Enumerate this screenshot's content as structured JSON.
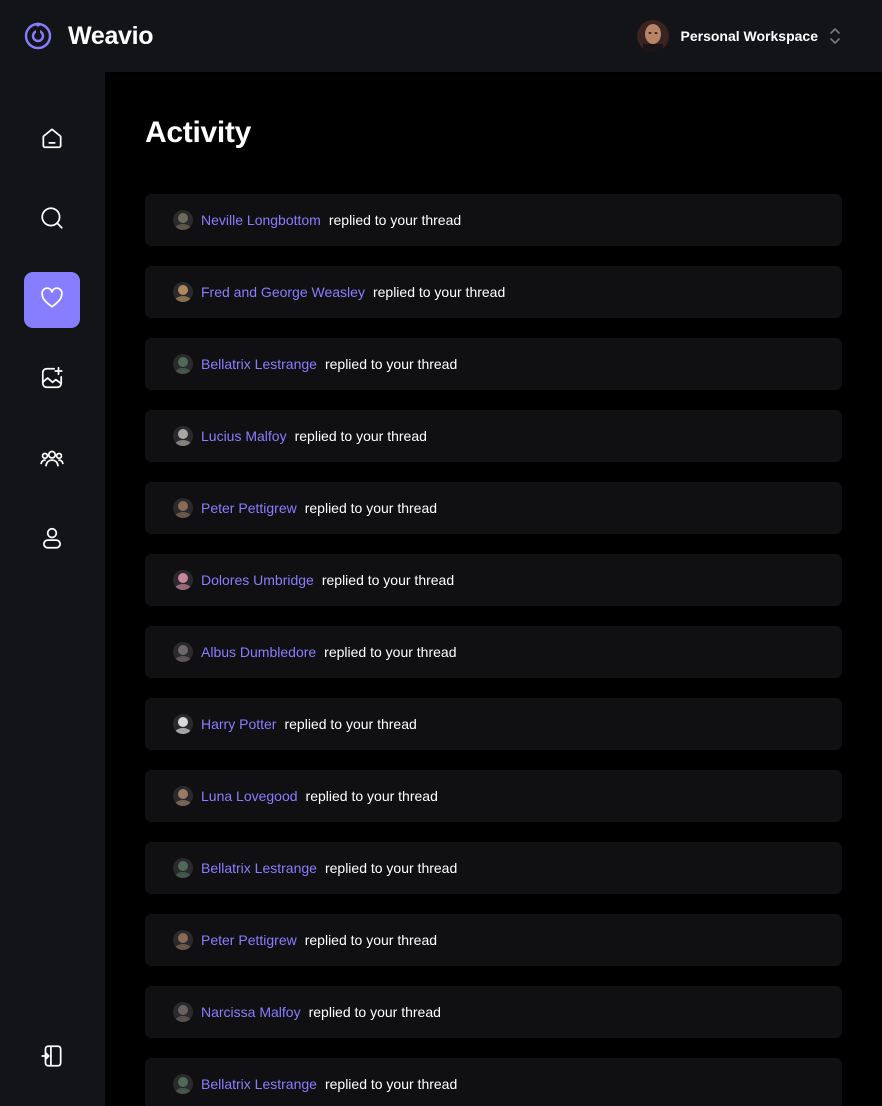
{
  "app": {
    "name": "Weavio"
  },
  "workspace": {
    "label": "Personal Workspace"
  },
  "page": {
    "title": "Activity"
  },
  "colors": {
    "accent": "#877eff",
    "bar": "#121417",
    "card": "#101012",
    "background": "#000000"
  },
  "nav": [
    {
      "id": "home",
      "icon": "home-icon",
      "active": false
    },
    {
      "id": "search",
      "icon": "search-icon",
      "active": false
    },
    {
      "id": "activity",
      "icon": "heart-icon",
      "active": true
    },
    {
      "id": "create",
      "icon": "image-add-icon",
      "active": false
    },
    {
      "id": "community",
      "icon": "people-icon",
      "active": false
    },
    {
      "id": "profile",
      "icon": "user-icon",
      "active": false
    },
    {
      "id": "logout",
      "icon": "logout-icon",
      "active": false
    }
  ],
  "activities": [
    {
      "name": "Neville Longbottom",
      "action": "replied to your thread",
      "avatar": "#6f6a58"
    },
    {
      "name": "Fred and George Weasley",
      "action": "replied to your thread",
      "avatar": "#b08a5c"
    },
    {
      "name": "Bellatrix Lestrange",
      "action": "replied to your thread",
      "avatar": "#4f6a55"
    },
    {
      "name": "Lucius Malfoy",
      "action": "replied to your thread",
      "avatar": "#a8a6a0"
    },
    {
      "name": "Peter Pettigrew",
      "action": "replied to your thread",
      "avatar": "#8a6a52"
    },
    {
      "name": "Dolores Umbridge",
      "action": "replied to your thread",
      "avatar": "#c8869a"
    },
    {
      "name": "Albus Dumbledore",
      "action": "replied to your thread",
      "avatar": "#6e6668"
    },
    {
      "name": "Harry Potter",
      "action": "replied to your thread",
      "avatar": "#d8d8d8"
    },
    {
      "name": "Luna Lovegood",
      "action": "replied to your thread",
      "avatar": "#9a7a62"
    },
    {
      "name": "Bellatrix Lestrange",
      "action": "replied to your thread",
      "avatar": "#4f6a55"
    },
    {
      "name": "Peter Pettigrew",
      "action": "replied to your thread",
      "avatar": "#8a6a52"
    },
    {
      "name": "Narcissa Malfoy",
      "action": "replied to your thread",
      "avatar": "#6a6060"
    },
    {
      "name": "Bellatrix Lestrange",
      "action": "replied to your thread",
      "avatar": "#4f6a55"
    }
  ]
}
